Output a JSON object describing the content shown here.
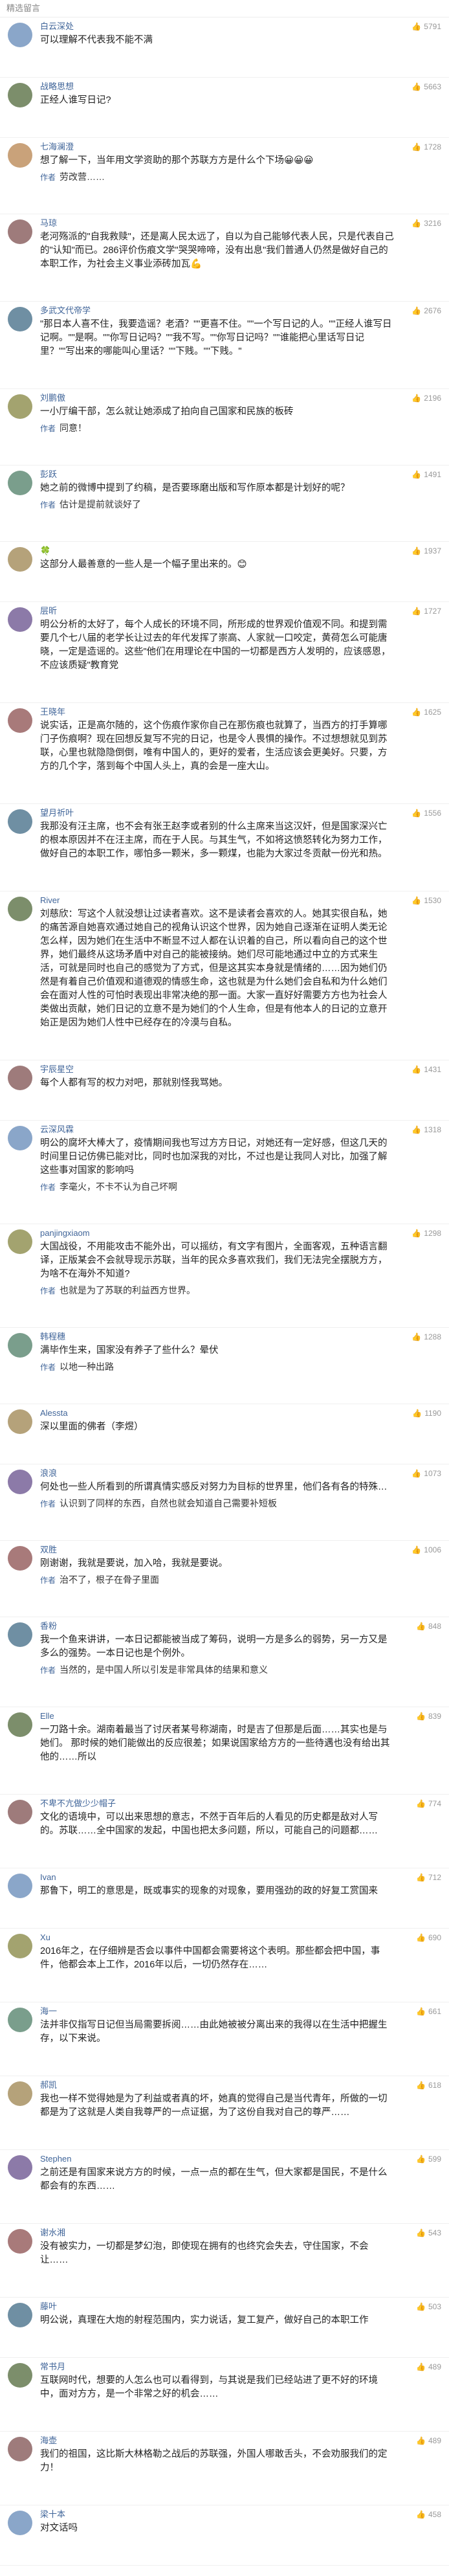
{
  "header": {
    "title": "精选留言"
  },
  "reply_label": "作者",
  "like_icon": "thumb-up-icon",
  "comments": [
    {
      "user": "白云深处",
      "likes": "5791",
      "color": "#8aa6c9",
      "text": "可以理解不代表我不能不满",
      "reply": ""
    },
    {
      "user": "战略思想",
      "likes": "5663",
      "color": "#7c8e6b",
      "text": "正经人谁写日记?",
      "reply": ""
    },
    {
      "user": "七海澜澄",
      "likes": "1728",
      "color": "#c9a27a",
      "text": "想了解一下，当年用文学资助的那个苏联方方是什么个下场😀😀😀",
      "reply": "劳改营……"
    },
    {
      "user": "马琼",
      "likes": "3216",
      "color": "#9e7b7b",
      "text": "老河殇派的\"自我救赎\"，还是离人民太远了，自以为自己能够代表人民，只是代表自己的\"认知\"而已。286评价伤痕文学\"哭哭啼啼，没有出息\"我们普通人仍然是做好自己的本职工作，为社会主义事业添砖加瓦💪",
      "reply": ""
    },
    {
      "user": "多武文代帝学",
      "likes": "2676",
      "color": "#6f8fa3",
      "text": "\"那日本人喜不住，我要造谣？老酒？\"\"更喜不住。\"\"一个写日记的人。\"\"正经人谁写日记啊。\"\"是啊。\"\"你写日记吗？\"\"我不写。\"\"你写日记吗？\"\"谁能把心里话写日记里？\"\"写出来的哪能叫心里话？\"\"下贱。\"\"下贱。\"",
      "reply": ""
    },
    {
      "user": "刘鹏傲",
      "likes": "2196",
      "color": "#a3a36f",
      "text": "一小厅编干部，怎么就让她添成了拍向自己国家和民族的板砖",
      "reply": "同意！"
    },
    {
      "user": "彭跃",
      "likes": "1491",
      "color": "#7a9e8c",
      "text": "她之前的微博中提到了约稿，是否要琢磨出版和写作原本都是计划好的呢？",
      "reply": "估计是提前就谈好了"
    },
    {
      "user": "🍀",
      "likes": "1937",
      "color": "#b5a27a",
      "text": "这部分人最善意的一些人是一个幅子里出来的。😊",
      "reply": ""
    },
    {
      "user": "层昕",
      "likes": "1727",
      "color": "#8c7aa8",
      "text": "明公分析的太好了，每个人成长的环境不同，所形成的世界观价值观不同。和提到需要几个七八届的老学长让过去的年代发挥了崇高、人家就一口咬定，黄荷怎么可能唐晓，一定是造谣的。这些\"他们在用理论在中国的一切都是西方人发明的，应该感恩，不应该质疑\"教育党",
      "reply": ""
    },
    {
      "user": "王晓年",
      "likes": "1625",
      "color": "#a87a7a",
      "text": "说实话，正是高尔随的，这个伤痕作家你自己在那伤痕也就算了，当西方的打手算哪门子伤痕啊？现在回想反复写不完的日记，也是令人畏惧的操作。不过想想就见到苏联，心里也就隐隐倒倒，唯有中国人的，更好的爱者，生活应该会更美好。只要，方方的几个字，落到每个中国人头上，真的会是一座大山。",
      "reply": ""
    },
    {
      "user": "望月祈叶",
      "likes": "1556",
      "color": "#6f8fa3",
      "text": "我那没有汪主席，也不会有张王赵李或者别的什么主席来当这汉奸，但是国家深兴亡的根本原因并不在汪主席，而在于人民。与其生气，不如将这愤怒转化为努力工作，做好自己的本职工作，哪怕多一颗米，多一颗煤，也能为大家过冬贡献一份光和热。",
      "reply": ""
    },
    {
      "user": "River",
      "likes": "1530",
      "color": "#7c8e6b",
      "text": "刘慈欣：写这个人就没想让过读者喜欢。这不是读者会喜欢的人。她其实很自私，她的痛苦源自她喜欢通过她自己的视角认识这个世界，因为她自己逐渐在证明人类无论怎么样，因为她们在生活中不断显不过人都在认识着的自己，所以看向自己的这个世界，她们最终从这场矛盾中对自己的能被接纳。她们尽可能地通过中立的方式来生活，可就是同时也自己的感觉为了方式，但是这其实本身就是情绪的……因为她们仍然是有着自己价值观和道德观的情感生命，这也就是为什么她们会自私和为什么她们会在面对人性的可怕时表现出非常决绝的那一面。大家一直好好需要方方也为社会人类做出贡献，她们日记的立意不是为她们的个人生命，但是有他本人的日记的立意开始正是因为她们人性中已经存在的冷漠与自私。",
      "reply": ""
    },
    {
      "user": "宇辰星空",
      "likes": "1431",
      "color": "#9e7b7b",
      "text": "每个人都有写的权力对吧，那就别怪我骂她。",
      "reply": ""
    },
    {
      "user": "云深风霖",
      "likes": "1318",
      "color": "#8aa6c9",
      "text": "明公的腐坏大棒大了，疫情期间我也写过方方日记，对她还有一定好感，但这几天的时间里日记仿佛已能对比，同时也加深我的对比，不过也是让我同人对比，加强了解这些事对国家的影响吗",
      "reply": "李毫火，不卡不认为自己坏啊"
    },
    {
      "user": "panjingxiaom",
      "likes": "1298",
      "color": "#a3a36f",
      "text": "大国战役，不用能攻击不能外出，可以摇纺，有文字有图片，全面客观，五种语言翻译，正版某会不会就导现示苏联，当年的民众多喜欢我们，我们无法完全摆脱方方，为啥不在海外不知道?",
      "reply": "也就是为了苏联的利益西方世界。"
    },
    {
      "user": "韩程穗",
      "likes": "1288",
      "color": "#7a9e8c",
      "text": "满毕作生来，国家没有养子了些什么？晕伏",
      "reply": "以地一种出路"
    },
    {
      "user": "Alessta",
      "likes": "1190",
      "color": "#b5a27a",
      "text": "深以里面的佛者（李煜）",
      "reply": ""
    },
    {
      "user": "浪浪",
      "likes": "1073",
      "color": "#8c7aa8",
      "text": "何处也一些人所看到的所谓真情实感反对努力为目标的世界里，他们各有各的特殊…",
      "reply": "认识到了同样的东西，自然也就会知道自己需要补短板"
    },
    {
      "user": "双胜",
      "likes": "1006",
      "color": "#a87a7a",
      "text": "刚谢谢，我就是要说，加入哈，我就是要说。",
      "reply": "治不了，根子在骨子里面"
    },
    {
      "user": "香粉",
      "likes": "848",
      "color": "#6f8fa3",
      "text": "我一个鱼来讲讲，一本日记都能被当成了筹码，说明一方是多么的弱势，另一方又是多么的强势。一本日记也是个例外。",
      "reply": "当然的，是中国人所以引发是非常具体的结果和意义"
    },
    {
      "user": "Elle",
      "likes": "839",
      "color": "#7c8e6b",
      "text": "一刀路十余。湖南着最当了讨厌者某号称湖南，时是吉了但那是后面……其实也是与她们。 那时候的她们能做出的反应很差；如果说国家给方方的一些待遇也没有给出其他的……所以",
      "reply": ""
    },
    {
      "user": "不卑不亢做少少帽子",
      "likes": "774",
      "color": "#9e7b7b",
      "text": "文化的语境中，可以出来思想的意志，不然于百年后的人看见的历史都是敌对人写的。苏联……全中国家的发起，中国也把太多问题，所以，可能自己的问题都……",
      "reply": ""
    },
    {
      "user": "Ivan",
      "likes": "712",
      "color": "#8aa6c9",
      "text": "那鲁下，明工的意思是，既或事实的现象的对现象，要用强劲的政的好复工赏国来",
      "reply": ""
    },
    {
      "user": "Xu",
      "likes": "690",
      "color": "#a3a36f",
      "text": "2016年之，在仔细辨是否会以事件中国都会需要将这个表明。那些都会把中国，事件，他都会本上工作，2016年以后，一切仍然存在……",
      "reply": ""
    },
    {
      "user": "海一",
      "likes": "661",
      "color": "#7a9e8c",
      "text": "法并非仅指写日记但当局需要拆阅……由此她被被分离出来的我得以在生活中把握生存，以下来说。",
      "reply": ""
    },
    {
      "user": "郝凯",
      "likes": "618",
      "color": "#b5a27a",
      "text": "我也一样不觉得她是为了利益或者真的坏，她真的觉得自己是当代青年，所做的一切都是为了这就是人类自我尊严的一点证据，为了这份自我对自己的尊严……",
      "reply": ""
    },
    {
      "user": "Stephen",
      "likes": "599",
      "color": "#8c7aa8",
      "text": "之前还是有国家来说方方的时候，一点一点的都在生气，但大家都是国民，不是什么都会有的东西……",
      "reply": ""
    },
    {
      "user": "谢水湘",
      "likes": "543",
      "color": "#a87a7a",
      "text": "没有被实力，一切都是梦幻泡，即使现在拥有的也终究会失去，守住国家，不会让……",
      "reply": ""
    },
    {
      "user": "藤叶",
      "likes": "503",
      "color": "#6f8fa3",
      "text": "明公说，真理在大炮的射程范围内，实力说话，复工复产，做好自己的本职工作",
      "reply": ""
    },
    {
      "user": "常书月",
      "likes": "489",
      "color": "#7c8e6b",
      "text": "互联网时代，想要的人怎么也可以看得到，与其说是我们已经站进了更不好的环境中，面对方方，是一个非常之好的机会……",
      "reply": ""
    },
    {
      "user": "海壶",
      "likes": "489",
      "color": "#9e7b7b",
      "text": "我们的祖国，这比斯大林格勒之战后的苏联强，外国人哪敢舌头，不会劝服我们的定力！",
      "reply": ""
    },
    {
      "user": "梁十本",
      "likes": "458",
      "color": "#8aa6c9",
      "text": "对文话吗",
      "reply": ""
    }
  ]
}
